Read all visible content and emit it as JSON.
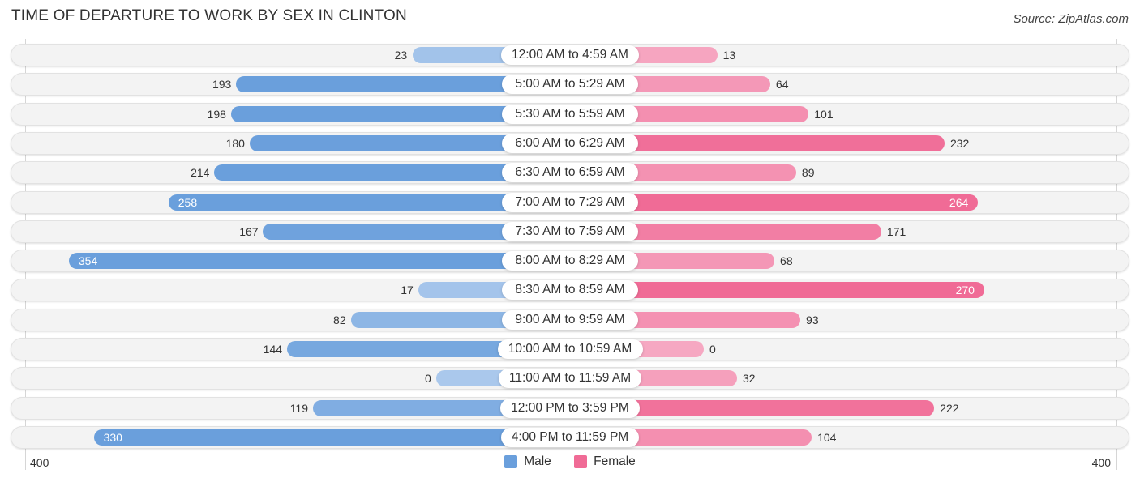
{
  "title": "TIME OF DEPARTURE TO WORK BY SEX IN CLINTON",
  "source": "Source: ZipAtlas.com",
  "colors": {
    "male_strong": "#6a9fdc",
    "male_light": "#aac8ec",
    "female_strong": "#f06b96",
    "female_light": "#f6a8c2"
  },
  "axis": {
    "left_label": "400",
    "right_label": "400"
  },
  "legend": [
    {
      "name": "Male",
      "color": "#6a9fdc"
    },
    {
      "name": "Female",
      "color": "#f06b96"
    }
  ],
  "chart_data": {
    "type": "bar",
    "orientation": "horizontal-diverging",
    "title": "TIME OF DEPARTURE TO WORK BY SEX IN CLINTON",
    "xlabel": "",
    "ylabel": "",
    "xlim": [
      -400,
      400
    ],
    "legend_position": "bottom-center",
    "categories": [
      "12:00 AM to 4:59 AM",
      "5:00 AM to 5:29 AM",
      "5:30 AM to 5:59 AM",
      "6:00 AM to 6:29 AM",
      "6:30 AM to 6:59 AM",
      "7:00 AM to 7:29 AM",
      "7:30 AM to 7:59 AM",
      "8:00 AM to 8:29 AM",
      "8:30 AM to 8:59 AM",
      "9:00 AM to 9:59 AM",
      "10:00 AM to 10:59 AM",
      "11:00 AM to 11:59 AM",
      "12:00 PM to 3:59 PM",
      "4:00 PM to 11:59 PM"
    ],
    "series": [
      {
        "name": "Male",
        "values": [
          23,
          193,
          198,
          180,
          214,
          258,
          167,
          354,
          17,
          82,
          144,
          0,
          119,
          330
        ]
      },
      {
        "name": "Female",
        "values": [
          13,
          64,
          101,
          232,
          89,
          264,
          171,
          68,
          270,
          93,
          0,
          32,
          222,
          104
        ]
      }
    ]
  }
}
